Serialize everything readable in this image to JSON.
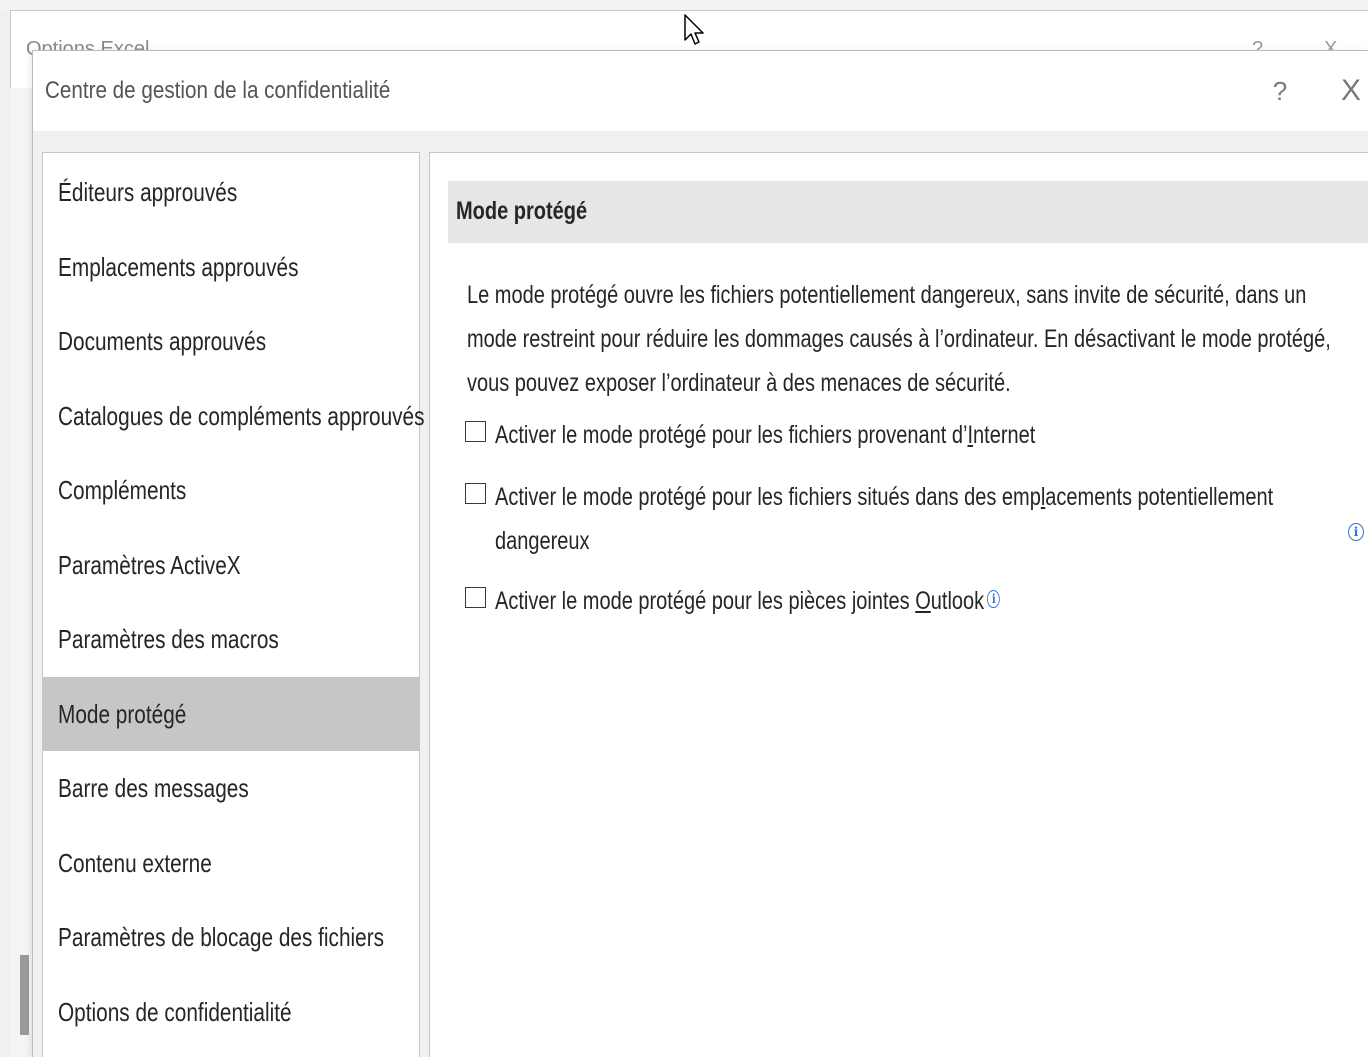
{
  "background_window": {
    "title": "Options Excel",
    "help_label": "?",
    "close_label": "X"
  },
  "dialog": {
    "title": "Centre de gestion de la confidentialité",
    "help_label": "?",
    "close_label": "X"
  },
  "sidebar": {
    "items": [
      {
        "label": "Éditeurs approuvés",
        "selected": false
      },
      {
        "label": "Emplacements approuvés",
        "selected": false
      },
      {
        "label": "Documents approuvés",
        "selected": false
      },
      {
        "label": "Catalogues de compléments approuvés",
        "selected": false
      },
      {
        "label": "Compléments",
        "selected": false
      },
      {
        "label": "Paramètres ActiveX",
        "selected": false
      },
      {
        "label": "Paramètres des macros",
        "selected": false
      },
      {
        "label": "Mode protégé",
        "selected": true
      },
      {
        "label": "Barre des messages",
        "selected": false
      },
      {
        "label": "Contenu externe",
        "selected": false
      },
      {
        "label": "Paramètres de blocage des fichiers",
        "selected": false
      },
      {
        "label": "Options de confidentialité",
        "selected": false
      }
    ]
  },
  "main": {
    "section_title": "Mode protégé",
    "description": "Le mode protégé ouvre les fichiers potentiellement dangereux, sans invite de sécurité, dans un mode restreint pour réduire les dommages causés à l’ordinateur. En désactivant le mode protégé, vous pouvez exposer l’ordinateur à des menaces de sécurité.",
    "options": {
      "internet": {
        "pre": "Activer le mode protégé pour les fichiers provenant d’",
        "key": "I",
        "post": "nternet",
        "checked": false
      },
      "unsafe_locations": {
        "pre": "Activer le mode protégé pour les fichiers situés dans des emp",
        "key": "l",
        "post": "acements potentiellement dangereux",
        "checked": false
      },
      "outlook": {
        "pre": "Activer le mode protégé pour les pièces jointes ",
        "key": "O",
        "post": "utlook",
        "checked": false
      }
    },
    "info_icon_glyph": "i"
  },
  "colors": {
    "selected_item_bg": "#c6c6c6",
    "section_header_bg": "#e6e6e6",
    "info_icon": "#2f6fd6"
  }
}
